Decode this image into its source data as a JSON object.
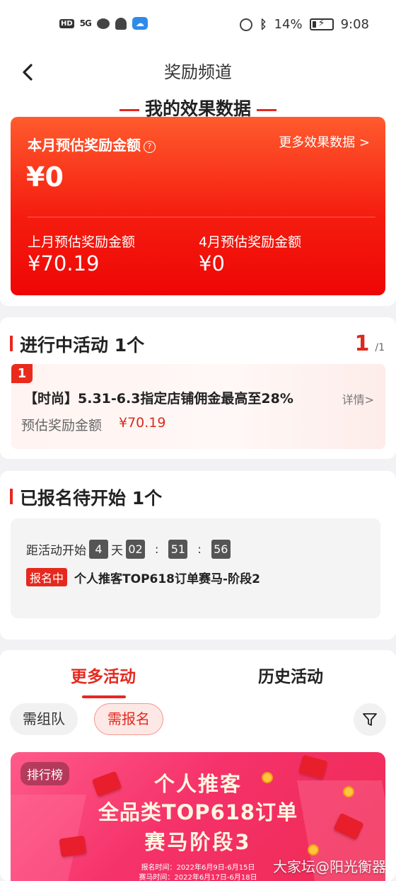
{
  "status_bar": {
    "hd": "HD",
    "signal": "5G",
    "battery_percent": "14%",
    "time": "9:08"
  },
  "nav": {
    "title": "奖励频道"
  },
  "effect": {
    "heading": "我的效果数据",
    "this_month_label": "本月预估奖励金额",
    "help": "?",
    "more_link": "更多效果数据 >",
    "this_month_amount": "¥0",
    "last_month_label": "上月预估奖励金额",
    "last_month_amount": "¥70.19",
    "april_label": "4月预估奖励金额",
    "april_amount": "¥0"
  },
  "active": {
    "title": "进行中活动  1个",
    "page_current": "1",
    "page_total": "/1",
    "item": {
      "rank": "1",
      "title": "【时尚】5.31-6.3指定店铺佣金最高至28%",
      "detail_link": "详情>",
      "est_label": "预估奖励金额",
      "est_value": "¥70.19"
    }
  },
  "signed": {
    "title": "已报名待开始  1个",
    "countdown_label": "距活动开始",
    "days": "4",
    "day_unit": "天",
    "hours": "02",
    "minutes": "51",
    "seconds": "56",
    "sep": ":",
    "status": "报名中",
    "name": "个人推客TOP618订单赛马-阶段2"
  },
  "more": {
    "tabs": [
      "更多活动",
      "历史活动"
    ],
    "filters": [
      "需组队",
      "需报名"
    ]
  },
  "banner": {
    "tag": "排行榜",
    "line1": "个人推客",
    "line2": "全品类TOP618订单",
    "line3": "赛马阶段3",
    "signup_time": "报名时间：2022年6月9日-6月15日",
    "race_time": "赛马时间：2022年6月17日-6月18日"
  },
  "watermark": "大家坛@阳光衡器",
  "colors": {
    "accent": "#e5291f",
    "card_gradient_top": "#ff5b2e",
    "card_gradient_bottom": "#ee0606"
  }
}
